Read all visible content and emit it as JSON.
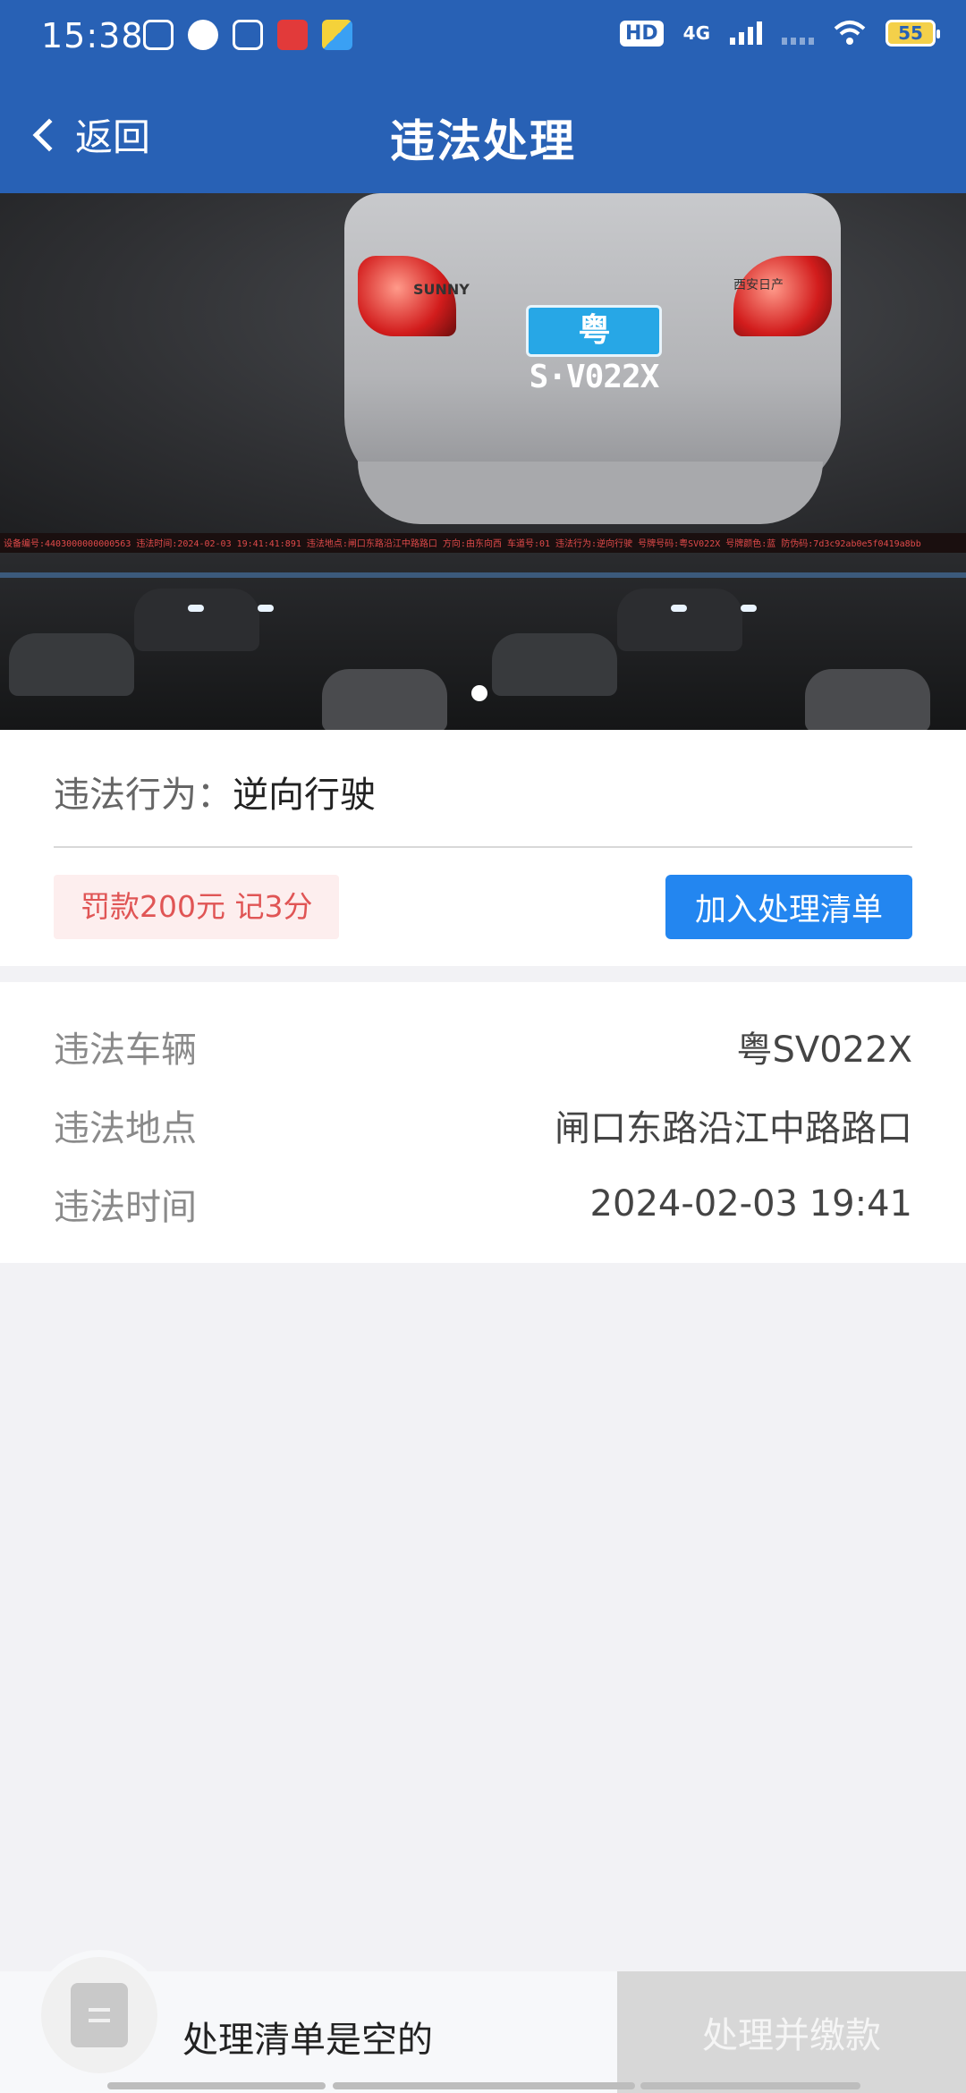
{
  "status_bar": {
    "time": "15:38",
    "hd_badge": "HD",
    "network": "4G",
    "battery": "55"
  },
  "header": {
    "back_label": "返回",
    "title": "违法处理"
  },
  "photo": {
    "brand": "SUNNY",
    "model": "西安日产",
    "plate_text": "粤S·V022X",
    "overlay_text": "设备编号:4403000000000563 违法时间:2024-02-03 19:41:41:891 违法地点:闸口东路沿江中路路口 方向:由东向西 车道号:01 违法行为:逆向行驶 号牌号码:粤SV022X 号牌颜色:蓝 防伪码:7d3c92ab0e5f0419a8bb",
    "page_indicator": "1/1"
  },
  "violation": {
    "behavior_label": "违法行为：",
    "behavior_value": "逆向行驶",
    "penalty": "罚款200元 记3分",
    "add_button": "加入处理清单"
  },
  "details": [
    {
      "label": "违法车辆",
      "value": "粤SV022X"
    },
    {
      "label": "违法地点",
      "value": "闸口东路沿江中路路口"
    },
    {
      "label": "违法时间",
      "value": "2024-02-03 19:41"
    }
  ],
  "bottom_bar": {
    "cart_text": "处理清单是空的",
    "pay_button": "处理并缴款"
  },
  "colors": {
    "header_blue": "#2861b5",
    "button_blue": "#2386f0",
    "penalty_red": "#e05555",
    "plate_blue": "#27a7e6"
  }
}
